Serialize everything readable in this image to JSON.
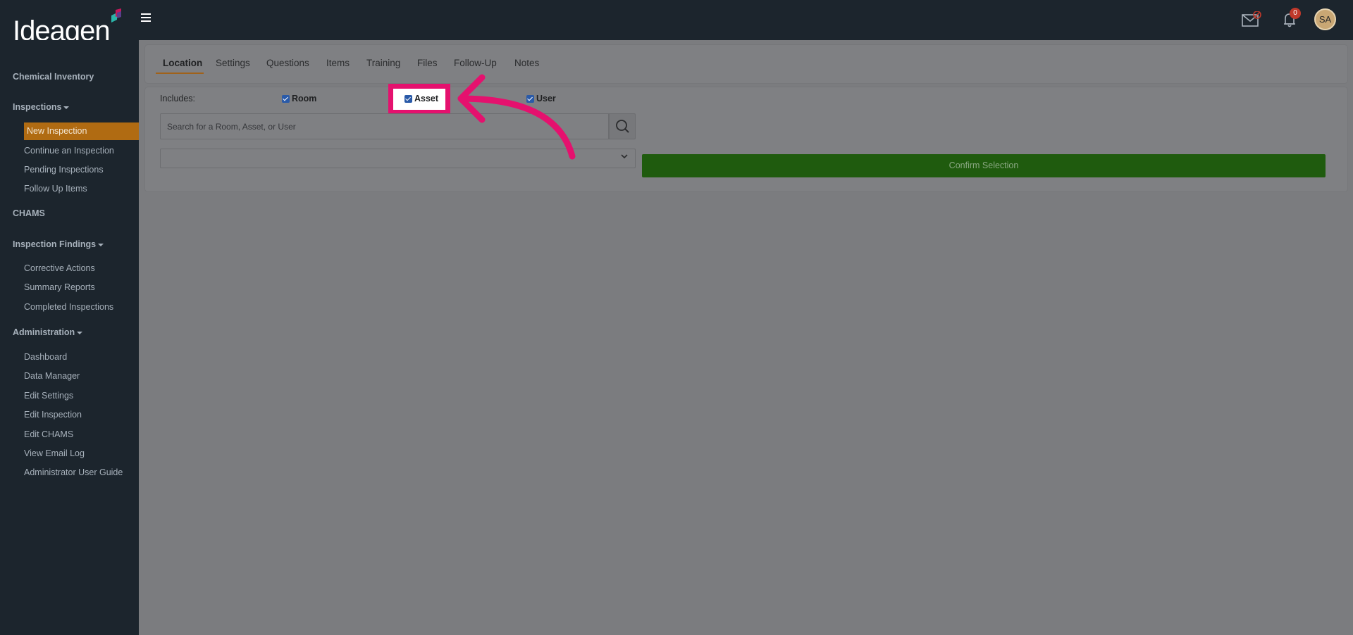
{
  "brand": {
    "logo_text": "Ideagen"
  },
  "header": {
    "notification_count": "0",
    "avatar_initials": "SA"
  },
  "sidebar": {
    "chemical_inventory": "Chemical Inventory",
    "inspections": "Inspections",
    "new_inspection": "New Inspection",
    "continue_inspection": "Continue an Inspection",
    "pending_inspections": "Pending Inspections",
    "follow_up_items": "Follow Up Items",
    "chams": "CHAMS",
    "inspection_findings": "Inspection Findings",
    "corrective_actions": "Corrective Actions",
    "summary_reports": "Summary Reports",
    "completed_inspections": "Completed Inspections",
    "administration": "Administration",
    "dashboard": "Dashboard",
    "data_manager": "Data Manager",
    "edit_settings": "Edit Settings",
    "edit_inspection": "Edit Inspection",
    "edit_chams": "Edit CHAMS",
    "view_email_log": "View Email Log",
    "admin_user_guide": "Administrator User Guide"
  },
  "tabs": [
    "Location",
    "Settings",
    "Questions",
    "Items",
    "Training",
    "Files",
    "Follow-Up",
    "Notes"
  ],
  "filters": {
    "includes_label": "Includes:",
    "room_label": "Room",
    "asset_label": "Asset",
    "user_label": "User"
  },
  "search": {
    "placeholder": "Search for a Room, Asset, or User"
  },
  "confirm_label": "Confirm Selection",
  "colors": {
    "highlight": "#e5116e",
    "accent": "#b06b12",
    "confirm": "#1f5b0e"
  }
}
